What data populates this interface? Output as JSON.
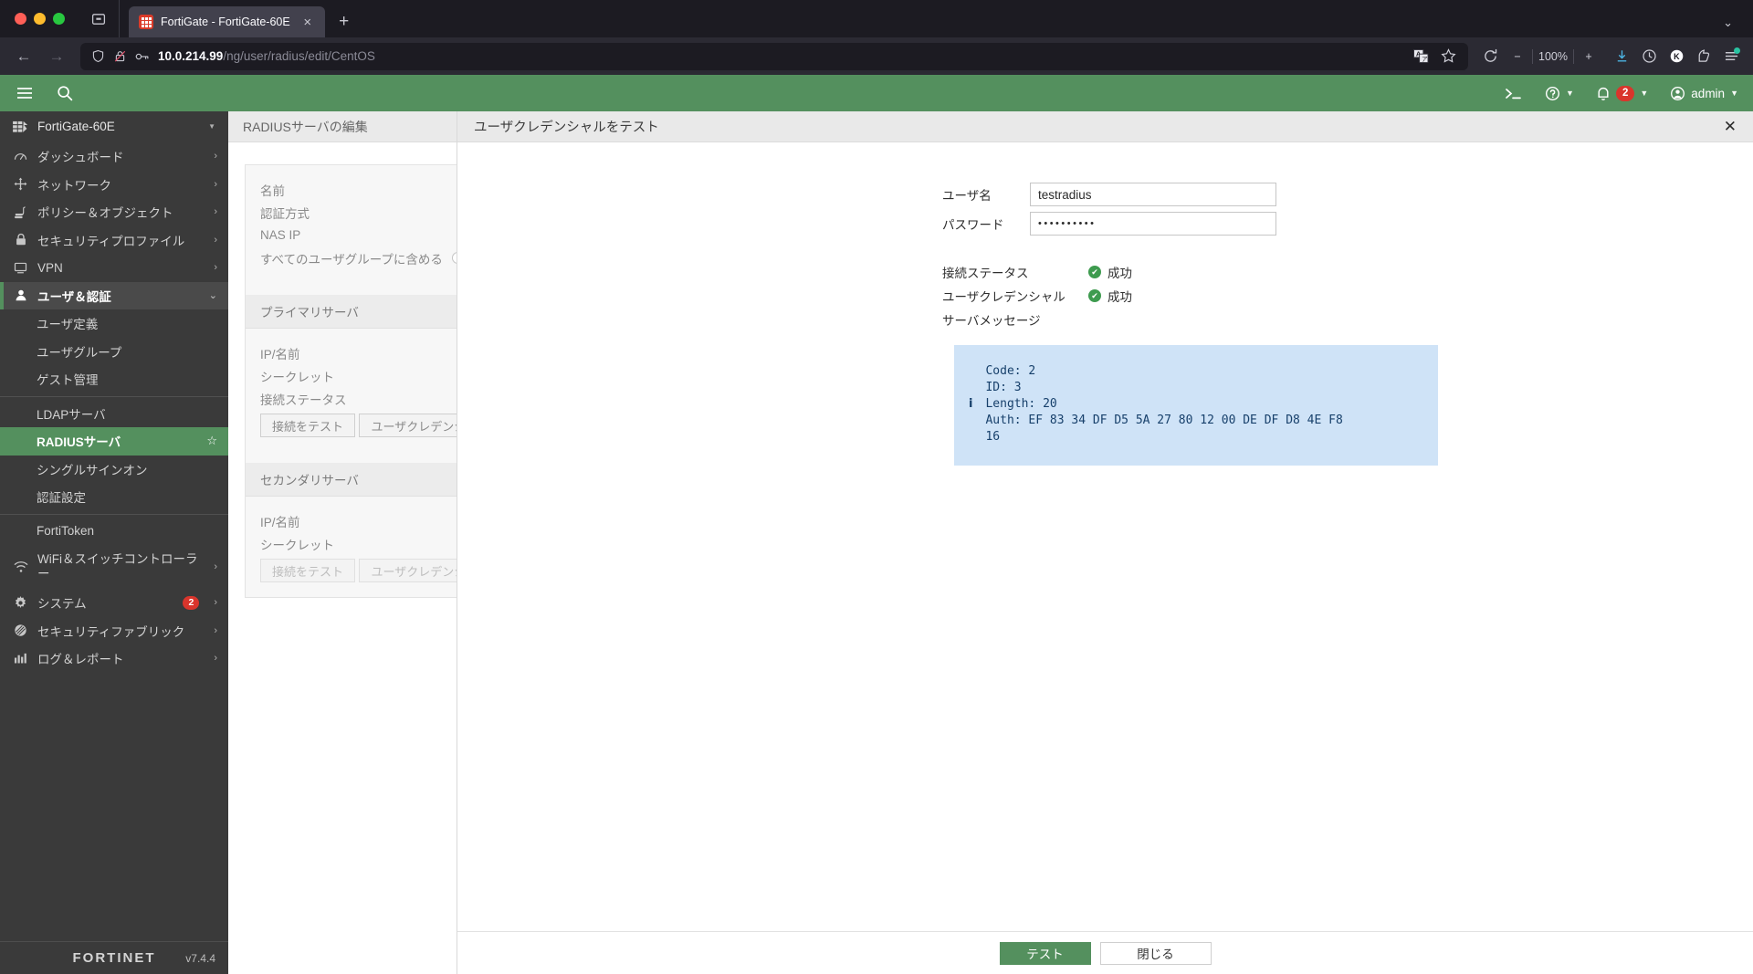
{
  "browser": {
    "tab": {
      "title": "FortiGate - FortiGate-60E",
      "favicon": "fortigate-favicon",
      "close": "×"
    },
    "new_tab_label": "+",
    "tab_list_chevron": "⌄",
    "nav": {
      "back": "←",
      "forward": "→"
    },
    "url": {
      "host": "10.0.214.99",
      "path": "/ng/user/radius/edit/CentOS"
    },
    "zoom_level": "100%",
    "zoom_out": "−",
    "zoom_in": "+",
    "icons": {
      "shield": "shield-icon",
      "lock_broken": "broken-lock-icon",
      "key": "key-icon",
      "translate": "translate-icon",
      "bookmark": "star-icon",
      "reload": "reload-icon",
      "download": "download-icon",
      "history": "clock-icon",
      "account": "k-account-icon",
      "extension": "extension-icon",
      "menu": "hamburger-menu-icon"
    }
  },
  "app": {
    "header": {
      "hamburger": "menu-icon",
      "search": "search-icon",
      "cli": ">_",
      "help": "?",
      "alerts_count": "2",
      "user": "admin"
    },
    "sidebar": {
      "device": "FortiGate-60E",
      "items": [
        {
          "label": "ダッシュボード",
          "icon": "dashboard-icon",
          "arrow": "›"
        },
        {
          "label": "ネットワーク",
          "icon": "network-icon",
          "arrow": "›"
        },
        {
          "label": "ポリシー＆オブジェクト",
          "icon": "policy-icon",
          "arrow": "›"
        },
        {
          "label": "セキュリティプロファイル",
          "icon": "shield-lock-icon",
          "arrow": "›"
        },
        {
          "label": "VPN",
          "icon": "monitor-icon",
          "arrow": "›"
        },
        {
          "label": "ユーザ＆認証",
          "icon": "user-icon",
          "arrow": "⌄"
        }
      ],
      "subitems": [
        {
          "label": "ユーザ定義"
        },
        {
          "label": "ユーザグループ"
        },
        {
          "label": "ゲスト管理"
        },
        {
          "label": "LDAPサーバ"
        },
        {
          "label": "RADIUSサーバ",
          "starred": "☆"
        },
        {
          "label": "シングルサインオン"
        },
        {
          "label": "認証設定"
        },
        {
          "label": "FortiToken"
        }
      ],
      "items_bottom": [
        {
          "label": "WiFi＆スイッチコントローラー",
          "icon": "wifi-icon",
          "arrow": "›"
        },
        {
          "label": "システム",
          "icon": "gear-icon",
          "arrow": "›",
          "badge": "2"
        },
        {
          "label": "セキュリティファブリック",
          "icon": "fabric-icon",
          "arrow": "›"
        },
        {
          "label": "ログ＆レポート",
          "icon": "chart-icon",
          "arrow": "›"
        }
      ],
      "footer_logo": "FORTINET",
      "version": "v7.4.4"
    },
    "background_page": {
      "title": "RADIUSサーバの編集",
      "fields": [
        "名前",
        "認証方式",
        "NAS IP"
      ],
      "include_all_groups": "すべてのユーザグループに含める",
      "primary_section": "プライマリサーバ",
      "primary_fields": [
        "IP/名前",
        "シークレット",
        "接続ステータス"
      ],
      "test_connection_button": "接続をテスト",
      "test_credentials_button": "ユーザクレデンシャルをテスト",
      "secondary_section": "セカンダリサーバ",
      "secondary_fields": [
        "IP/名前",
        "シークレット"
      ],
      "secondary_test_connection_button": "接続をテスト",
      "secondary_test_credentials_button": "ユーザクレデンシャルをテスト"
    },
    "dialog": {
      "title": "ユーザクレデンシャルをテスト",
      "close": "✕",
      "username_label": "ユーザ名",
      "username_value": "testradius",
      "password_label": "パスワード",
      "password_value": "••••••••••",
      "connection_status_label": "接続ステータス",
      "connection_status_value": "成功",
      "credentials_label": "ユーザクレデンシャル",
      "credentials_value": "成功",
      "server_message_label": "サーバメッセージ",
      "server_message_icon": "i",
      "server_message": "Code: 2\nID: 3\nLength: 20\nAuth: EF 83 34 DF D5 5A 27 80 12 00 DE DF D8 4E F8\n16",
      "test_button": "テスト",
      "close_button": "閉じる"
    }
  },
  "colors": {
    "fortigate_green": "#54905e",
    "alert_red": "#d9352c",
    "message_bg": "#cfe3f7",
    "message_fg": "#17406b",
    "sidebar_bg": "#3a3a3a"
  }
}
